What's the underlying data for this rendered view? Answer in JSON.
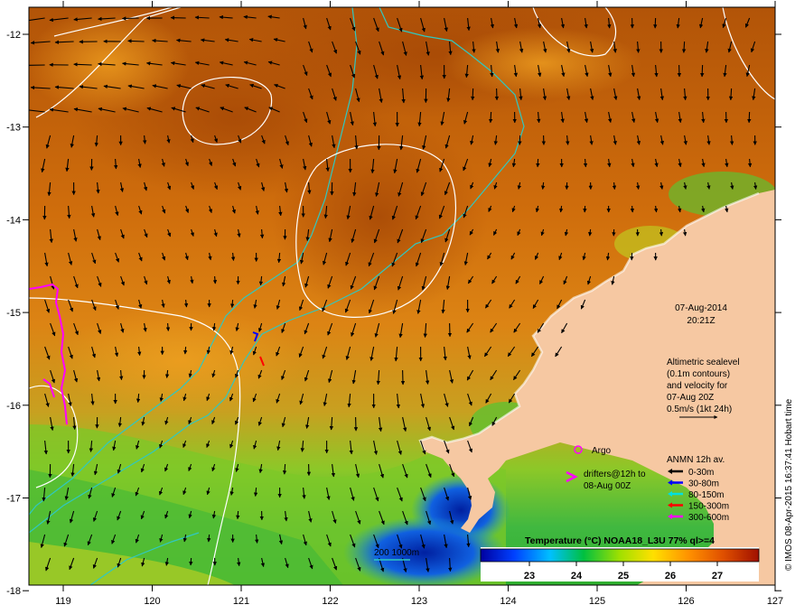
{
  "map": {
    "date": "07-Aug-2014",
    "time": "20:21Z",
    "x_ticks": [
      "119",
      "120",
      "121",
      "122",
      "123",
      "124",
      "125",
      "126",
      "127"
    ],
    "y_ticks": [
      "-12",
      "-13",
      "-14",
      "-15",
      "-16",
      "-17",
      "-18"
    ],
    "altimetry_note": [
      "Altimetric sealevel",
      "(0.1m contours)",
      "and velocity for",
      "07-Aug 20Z",
      "0.5m/s (1kt 24h)"
    ],
    "argo_label": "Argo",
    "drifters_label": [
      "drifters@12h to",
      "08-Aug 00Z"
    ],
    "anmn_title": "ANMN 12h av.",
    "anmn_items": [
      {
        "label": "0-30m",
        "color": "#000000"
      },
      {
        "label": "30-80m",
        "color": "#0000ff"
      },
      {
        "label": "80-150m",
        "color": "#00e0e0"
      },
      {
        "label": "150-300m",
        "color": "#ff0000"
      },
      {
        "label": "300-600m",
        "color": "#ff00ff"
      }
    ],
    "isobath_label": "200  1000m",
    "colorbar_title": "Temperature (°C) NOAA18_L3U 77% ql>=4",
    "colorbar_ticks": [
      "23",
      "24",
      "25",
      "26",
      "27"
    ],
    "credit": "© IMOS 08-Apr-2015 16:37:41 Hobart time",
    "colors": {
      "land": "#f6c8a2",
      "sst_warm": "#b85a08",
      "sst_mid": "#d8780e",
      "sst_green": "#6cc828",
      "sst_blue": "#1040d0",
      "isobath": "#30c8c0",
      "drifter": "#ff00ff",
      "contour": "#ffffff"
    }
  }
}
